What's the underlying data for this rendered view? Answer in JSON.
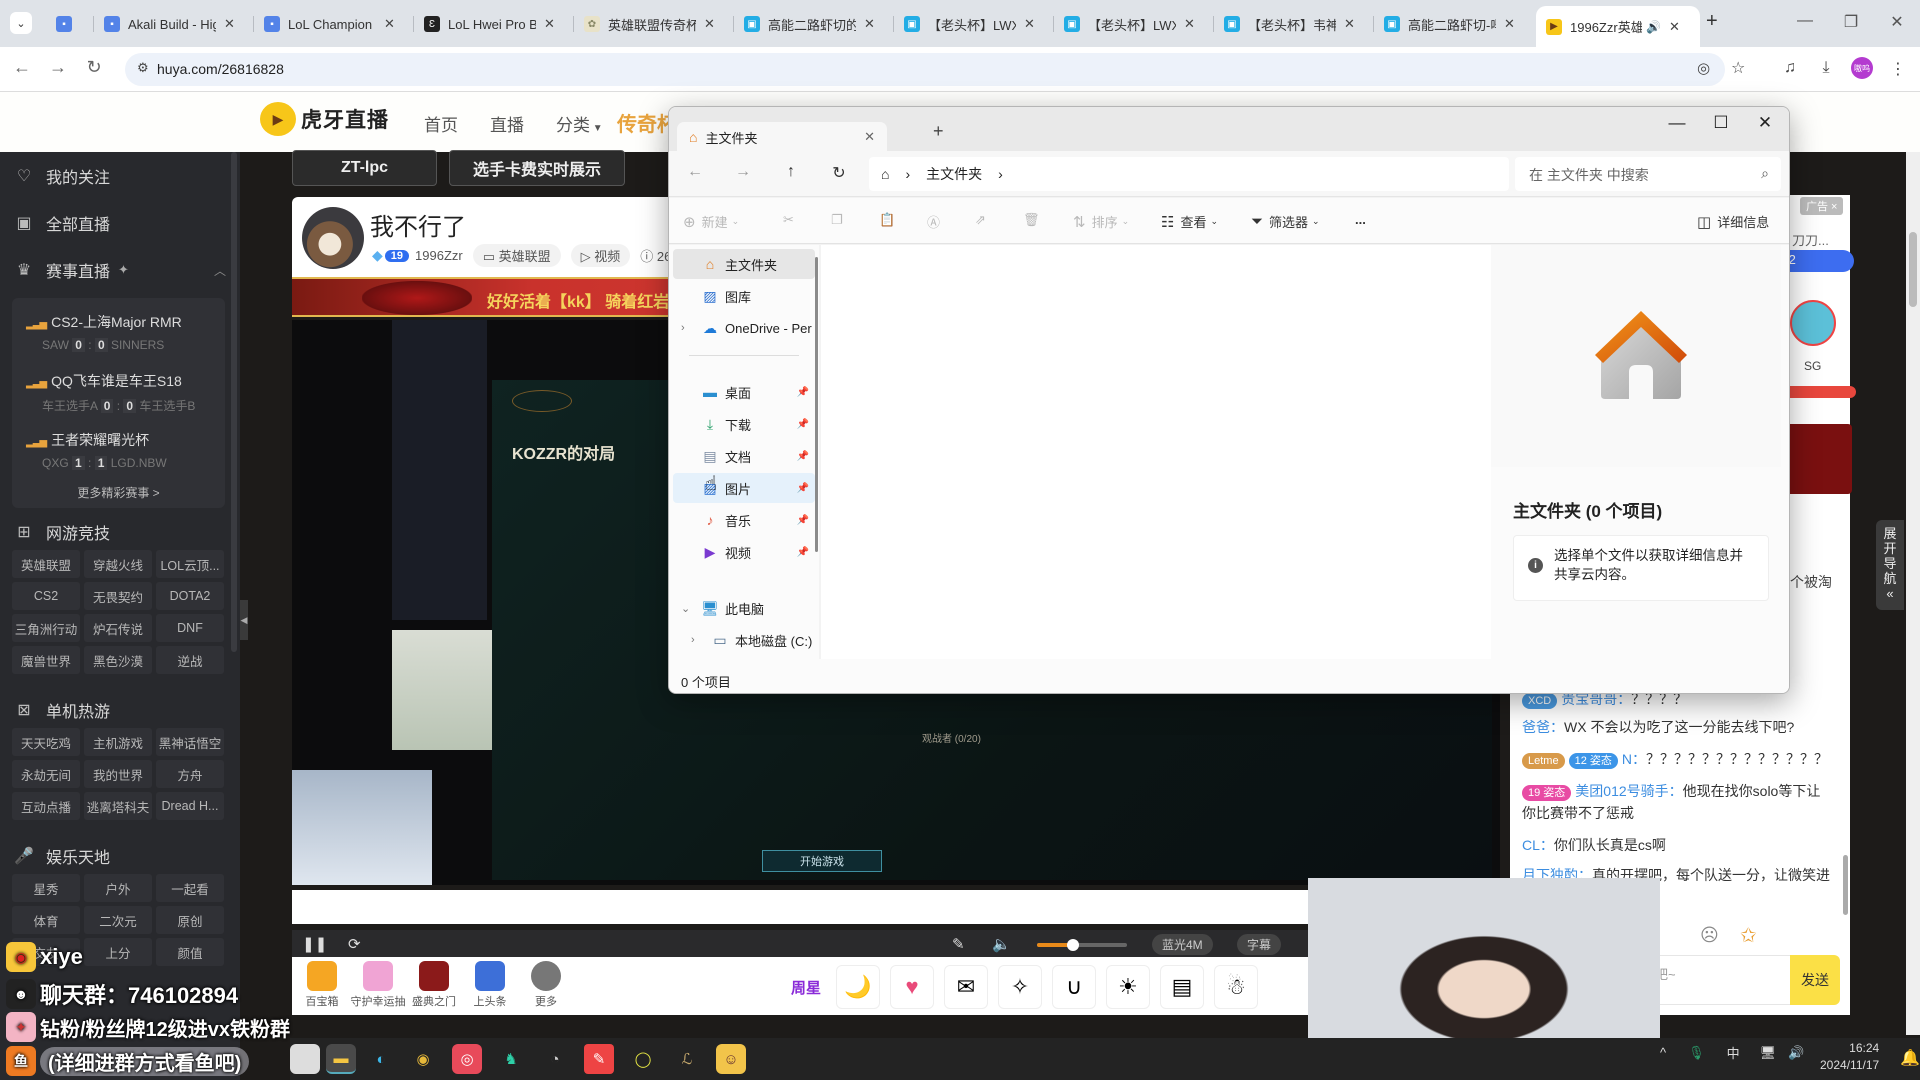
{
  "browser": {
    "tabs": [
      {
        "title": "",
        "favicon": "op-gg"
      },
      {
        "title": "Akali Build - Hig",
        "favicon": "op-gg"
      },
      {
        "title": "LoL Champion :",
        "favicon": "op-gg"
      },
      {
        "title": "LoL Hwei Pro Bu",
        "favicon": "mobalytics"
      },
      {
        "title": "英雄联盟传奇杯S",
        "favicon": "lol-legend"
      },
      {
        "title": "高能二路虾切的",
        "favicon": "bilibili"
      },
      {
        "title": "【老头杯】LWX",
        "favicon": "bilibili"
      },
      {
        "title": "【老头杯】LWX",
        "favicon": "bilibili"
      },
      {
        "title": "【老头杯】韦神",
        "favicon": "bilibili"
      },
      {
        "title": "高能二路虾切-哔",
        "favicon": "bilibili"
      },
      {
        "title": "1996Zzr英雄",
        "favicon": "huya",
        "active": true,
        "audio": true
      }
    ],
    "new_tab": "+",
    "url": "huya.com/26816828",
    "profile_label": "嗷呜"
  },
  "huya": {
    "logo": "虎牙直播",
    "nav": [
      "首页",
      "直播",
      "分类"
    ],
    "nav_legend": "传奇杯",
    "top_buttons": [
      "ZT-lpc",
      "选手卡费实时展示"
    ],
    "sidebar": {
      "main": [
        "我的关注",
        "全部直播",
        "赛事直播"
      ],
      "matches": [
        {
          "title": "CS2-上海Major RMR",
          "team_a": "SAW",
          "score_a": "0",
          "score_b": "0",
          "team_b": "SINNERS"
        },
        {
          "title": "QQ飞车谁是车王S18",
          "team_a": "车王选手A",
          "score_a": "0",
          "score_b": "0",
          "team_b": "车王选手B"
        },
        {
          "title": "王者荣耀曙光杯",
          "team_a": "QXG",
          "score_a": "1",
          "score_b": "1",
          "team_b": "LGD.NBW"
        }
      ],
      "more_matches": "更多精彩赛事 >",
      "sections": [
        {
          "title": "网游竞技",
          "items": [
            "英雄联盟",
            "穿越火线",
            "LOL云顶...",
            "CS2",
            "无畏契约",
            "DOTA2",
            "三角洲行动",
            "炉石传说",
            "DNF",
            "魔兽世界",
            "黑色沙漠",
            "逆战"
          ]
        },
        {
          "title": "单机热游",
          "items": [
            "天天吃鸡",
            "主机游戏",
            "黑神话悟空",
            "永劫无间",
            "我的世界",
            "方舟",
            "互动点播",
            "逃离塔科夫",
            "Dread H..."
          ]
        },
        {
          "title": "娱乐天地",
          "items": [
            "星秀",
            "户外",
            "一起看",
            "体育",
            "二次元",
            "原创",
            "交友",
            "上分",
            "颜值"
          ]
        }
      ]
    },
    "room": {
      "title": "我不行了",
      "level": "19",
      "streamer": "1996Zzr",
      "category": "英雄联盟",
      "video": "视频",
      "room_id_prefix": "26"
    },
    "banner": "好好活着【kk】 骑着红岩雄狮驾临",
    "video": {
      "lobby_title": "KOZZR的对局",
      "start_button": "开始游戏",
      "spectators": "观战者 (0/20)",
      "quality": "蓝光4M",
      "subtitle": "字幕",
      "volume_pct": 40
    },
    "gift_tools": [
      "百宝箱",
      "守护幸运抽",
      "盛典之门",
      "上头条",
      "更多"
    ],
    "gifts": [
      "周星",
      "晚安",
      "爱心",
      "信封",
      "魔法棒",
      "磁铁",
      "猫",
      "卡片",
      "雪人"
    ],
    "ad": "广告 ×",
    "side_widget": {
      "text": "刀刀...",
      "count": "* 2",
      "team": "SG",
      "snippet": "个被淘"
    },
    "expand_nav": "展开导航",
    "chat": [
      {
        "nick": "贵宝哥哥",
        "text": "？？？？",
        "badge": "XCD"
      },
      {
        "nick": "爸爸",
        "text": "WX 不会以为吃了这一分能去线下吧?"
      },
      {
        "nick": "N",
        "text": "？？？？？？？？？？？？？",
        "badge": "12 姿态",
        "badge2": "Letme"
      },
      {
        "nick": "美团012号骑手",
        "text": "他现在找你solo等下让你比赛带不了惩戒",
        "badge": "19 姿态"
      },
      {
        "nick": "CL",
        "text": "你们队长真是cs啊"
      },
      {
        "nick": "月下独酌",
        "text": "真的开摆吧，每个队送一分，让微笑进"
      }
    ],
    "chat_placeholder": "吧~",
    "send": "发送"
  },
  "explorer": {
    "tab_title": "主文件夹",
    "breadcrumb": [
      "主文件夹"
    ],
    "search_placeholder": "在 主文件夹 中搜索",
    "commands": {
      "new": "新建",
      "sort": "排序",
      "view": "查看",
      "filter": "筛选器",
      "more": "...",
      "details": "详细信息"
    },
    "nav": [
      {
        "label": "主文件夹",
        "icon": "home",
        "selected": true
      },
      {
        "label": "图库",
        "icon": "gallery"
      },
      {
        "label": "OneDrive - Per",
        "icon": "onedrive",
        "expandable": true
      },
      {
        "label": "桌面",
        "icon": "desktop",
        "pinned": true
      },
      {
        "label": "下载",
        "icon": "download",
        "pinned": true
      },
      {
        "label": "文档",
        "icon": "document",
        "pinned": true
      },
      {
        "label": "图片",
        "icon": "pictures",
        "pinned": true,
        "hover": true
      },
      {
        "label": "音乐",
        "icon": "music",
        "pinned": true
      },
      {
        "label": "视频",
        "icon": "video",
        "pinned": true
      },
      {
        "label": "此电脑",
        "icon": "pc",
        "expanded": true
      },
      {
        "label": "本地磁盘 (C:)",
        "icon": "drive",
        "expandable": true
      }
    ],
    "details_title": "主文件夹 (0 个项目)",
    "details_info": "选择单个文件以获取详细信息并共享云内容。",
    "status": "0 个项目"
  },
  "overlay": {
    "weibo": "xiye",
    "qq_group": "聊天群：746102894",
    "fan_group": "钻粉/粉丝牌12级进vx铁粉群",
    "note": "(详细进群方式看鱼吧)"
  },
  "taskbar": {
    "ime": "中",
    "time": "16:24",
    "date": "2024/11/17"
  }
}
